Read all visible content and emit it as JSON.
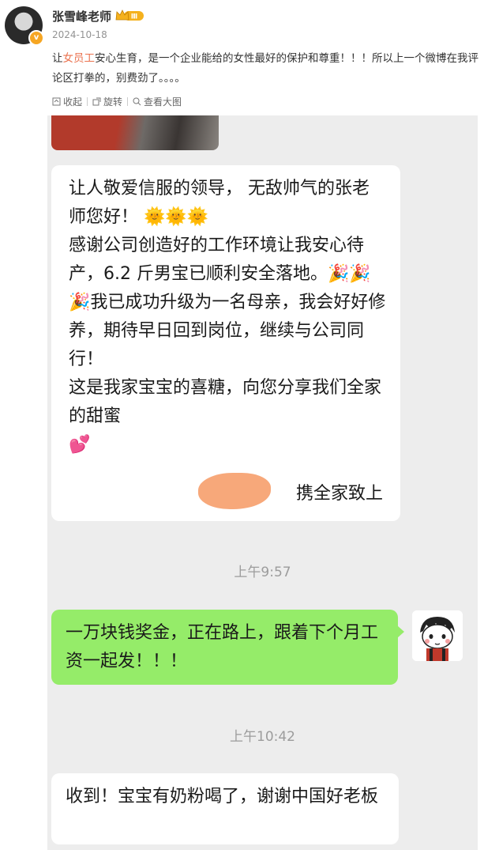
{
  "post": {
    "author": "张雪峰老师",
    "level_badge": "Ⅲ",
    "date": "2024-10-18",
    "text_before": "让",
    "text_highlight": "女员工",
    "text_after": "安心生育，是一个企业能给的女性最好的保护和尊重！！！所以上一个微博在我评论区打拳的，别费劲了。。。。"
  },
  "toolbar": {
    "collapse": "收起",
    "rotate": "旋转",
    "view_large": "查看大图"
  },
  "chat": {
    "message1": "让人敬爱信服的领导， 无敌帅气的张老师您好！ 🌞🌞🌞\n感谢公司创造好的工作环境让我安心待产，6.2 斤男宝已顺利安全落地。🎉🎉🎉我已成功升级为一名母亲，我会好好修养，期待早日回到岗位，继续与公司同\n行！\n这是我家宝宝的喜糖，向您分享我们全家的甜蜜\n💕",
    "signature": "携全家致上",
    "time1": "上午9:57",
    "reply": "一万块钱奖金，正在路上，跟着下个月工资一起发！！！",
    "time2": "上午10:42",
    "message2": "收到！宝宝有奶粉喝了，谢谢中国好老板"
  },
  "colors": {
    "highlight": "#eb7350",
    "sent_bubble": "#95ec69",
    "chat_bg": "#ededed"
  }
}
